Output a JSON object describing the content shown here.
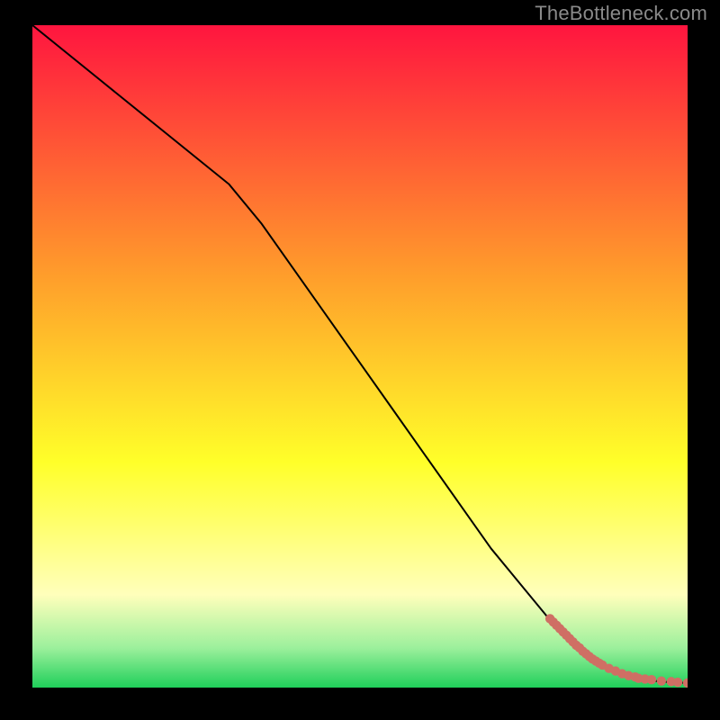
{
  "watermark": "TheBottleneck.com",
  "colors": {
    "frame": "#000000",
    "curve": "#000000",
    "marker": "#cf6f64",
    "gradient_top": "#ff153f",
    "gradient_mid_upper": "#ff9e2b",
    "gradient_mid": "#ffff29",
    "gradient_mid_lower": "#ffffbb",
    "gradient_near_bottom": "#9cf09c",
    "gradient_bottom": "#1fcf5a"
  },
  "chart_data": {
    "type": "line",
    "title": "",
    "xlabel": "",
    "ylabel": "",
    "xlim": [
      0,
      100
    ],
    "ylim": [
      0,
      100
    ],
    "series": [
      {
        "name": "curve",
        "x": [
          0,
          10,
          20,
          30,
          35,
          40,
          45,
          50,
          55,
          60,
          65,
          70,
          75,
          80,
          82.5,
          85,
          87.5,
          90,
          92.5,
          95,
          97.5,
          100
        ],
        "y": [
          100,
          92,
          84,
          76,
          70,
          63,
          56,
          49,
          42,
          35,
          28,
          21,
          15,
          9,
          6.5,
          4.5,
          3,
          2,
          1.4,
          1,
          0.8,
          0.7
        ]
      },
      {
        "name": "markers",
        "x": [
          79,
          79.5,
          80,
          80.5,
          81,
          81.5,
          82,
          82.5,
          83,
          83.5,
          84,
          84.5,
          85,
          85.5,
          86,
          86.5,
          87,
          88,
          89,
          90,
          91,
          92,
          92.5,
          93.5,
          94.5,
          96,
          97.5,
          98.5,
          100
        ],
        "y": [
          10.4,
          9.9,
          9.4,
          8.9,
          8.4,
          7.9,
          7.4,
          6.9,
          6.4,
          6,
          5.5,
          5.1,
          4.7,
          4.3,
          4,
          3.7,
          3.4,
          2.9,
          2.5,
          2.1,
          1.8,
          1.6,
          1.4,
          1.3,
          1.2,
          1,
          0.9,
          0.8,
          0.7
        ]
      }
    ]
  }
}
